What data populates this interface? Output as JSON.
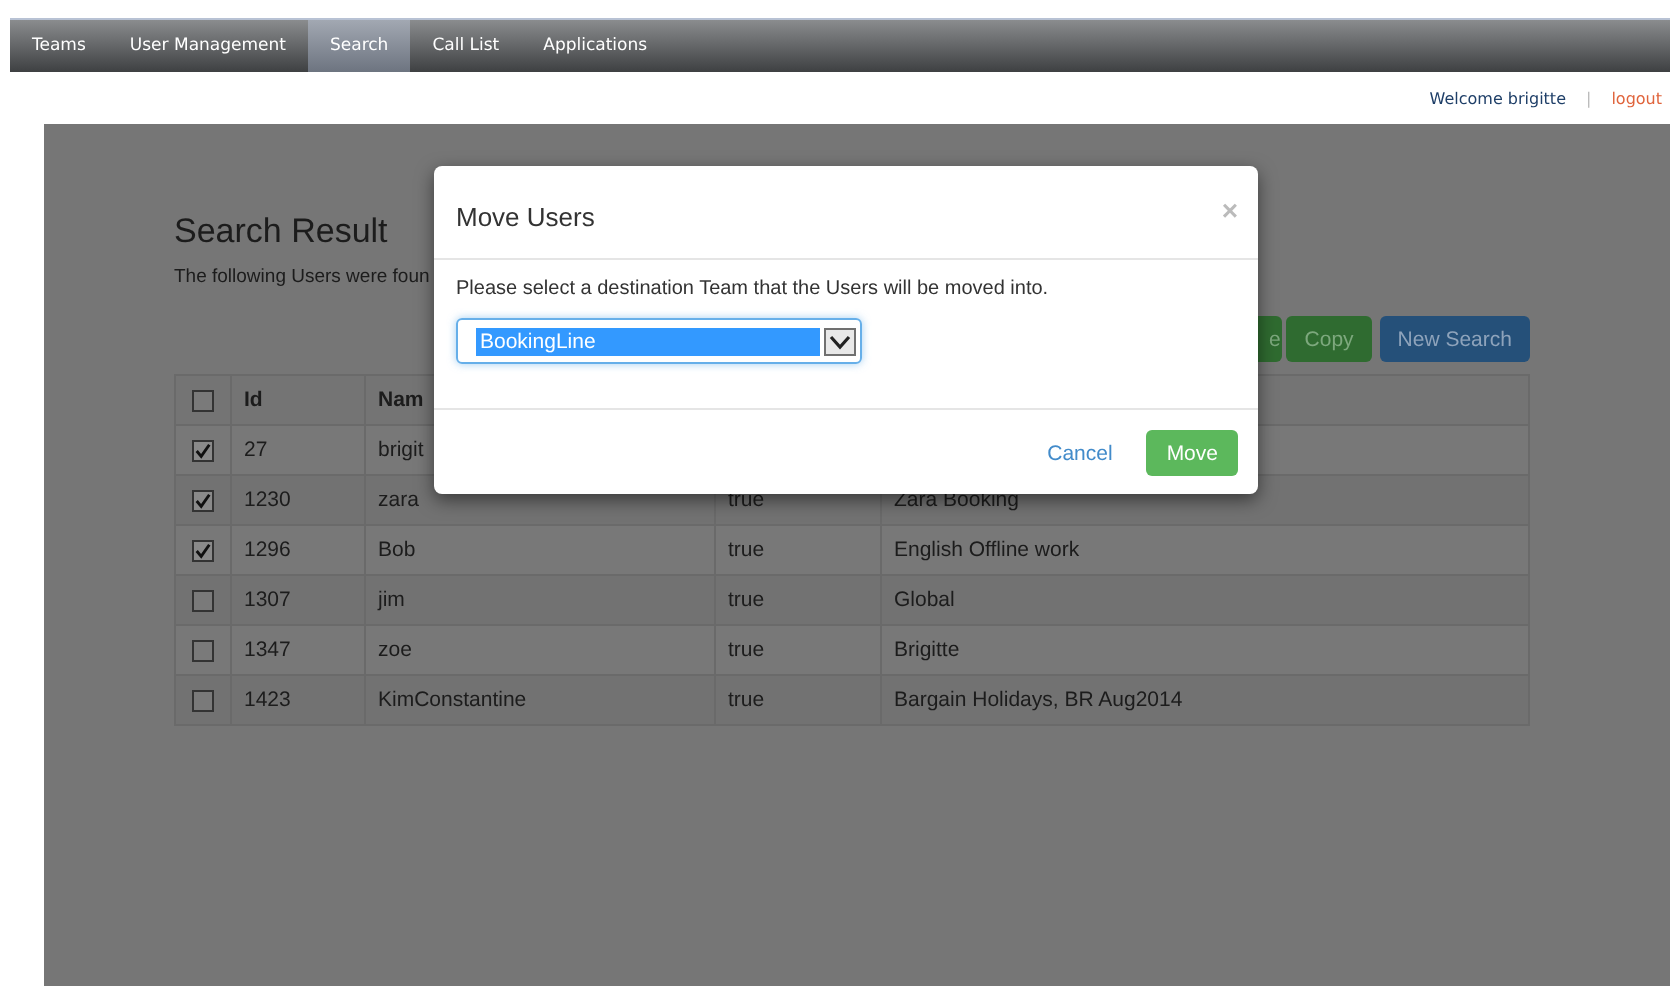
{
  "nav": {
    "tabs": [
      {
        "label": "Teams",
        "selected": false
      },
      {
        "label": "User Management",
        "selected": false
      },
      {
        "label": "Search",
        "selected": true
      },
      {
        "label": "Call List",
        "selected": false
      },
      {
        "label": "Applications",
        "selected": false
      }
    ]
  },
  "user_bar": {
    "welcome": "Welcome brigitte",
    "separator": "|",
    "logout": "logout"
  },
  "page": {
    "title": "Search Result",
    "intro": "The following Users were foun",
    "buttons": [
      {
        "label": "e",
        "kind": "success"
      },
      {
        "label": "Copy",
        "kind": "success"
      },
      {
        "label": "New Search",
        "kind": "primary"
      }
    ],
    "table": {
      "header_checked": false,
      "columns": [
        "Id",
        "Nam"
      ],
      "rows": [
        {
          "checked": true,
          "cells": [
            "27",
            "brigit"
          ]
        },
        {
          "checked": true,
          "cells": [
            "1230",
            "zara",
            "true",
            "Zara Booking"
          ]
        },
        {
          "checked": true,
          "cells": [
            "1296",
            "Bob",
            "true",
            "English Offline work"
          ]
        },
        {
          "checked": false,
          "cells": [
            "1307",
            "jim",
            "true",
            "Global"
          ]
        },
        {
          "checked": false,
          "cells": [
            "1347",
            "zoe",
            "true",
            "Brigitte"
          ]
        },
        {
          "checked": false,
          "cells": [
            "1423",
            "KimConstantine",
            "true",
            "Bargain Holidays, BR Aug2014"
          ]
        }
      ]
    }
  },
  "modal": {
    "title": "Move Users",
    "close": "×",
    "message": "Please select a destination Team that the Users will be moved into.",
    "select": {
      "value": "BookingLine"
    },
    "buttons": [
      {
        "label": "Cancel",
        "kind": "link"
      },
      {
        "label": "Move",
        "kind": "success"
      }
    ]
  }
}
